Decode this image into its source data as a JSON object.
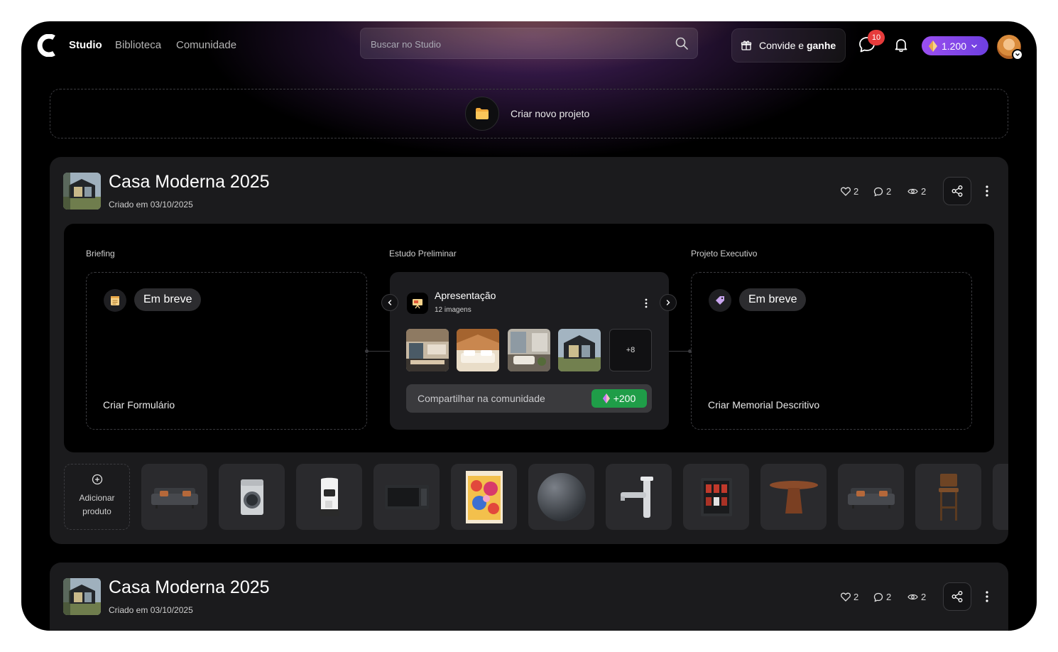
{
  "header": {
    "nav": [
      "Studio",
      "Biblioteca",
      "Comunidade"
    ],
    "search_placeholder": "Buscar no Studio",
    "invite_prefix": "Convide e",
    "invite_bold": "ganhe",
    "notifications_count": "10",
    "credits": "1.200"
  },
  "create_project": {
    "label": "Criar novo projeto"
  },
  "projects": [
    {
      "title": "Casa Moderna 2025",
      "created": "Criado em 03/10/2025",
      "likes": "2",
      "comments": "2",
      "views": "2",
      "stages": {
        "briefing": {
          "label": "Briefing",
          "status": "Em breve",
          "action": "Criar Formulário"
        },
        "preliminar": {
          "label": "Estudo Preliminar",
          "title": "Apresentação",
          "count": "12 imagens",
          "more_images": "+8",
          "share_label": "Compartilhar na comunidade",
          "reward": "+200"
        },
        "executivo": {
          "label": "Projeto Executivo",
          "status": "Em breve",
          "action": "Criar Memorial Descritivo"
        }
      },
      "add_product": {
        "line1": "Adicionar",
        "line2": "produto"
      },
      "products": [
        "sofa",
        "washing-machine",
        "coffee-machine",
        "microwave",
        "poster",
        "sphere",
        "faucet",
        "wine-fridge",
        "round-table",
        "sofa",
        "bar-stool"
      ]
    },
    {
      "title": "Casa Moderna 2025",
      "created": "Criado em 03/10/2025",
      "likes": "2",
      "comments": "2",
      "views": "2"
    }
  ],
  "colors": {
    "accent_purple": "#8b48ee",
    "reward_green": "#1f9d48",
    "badge_red": "#e63b3b"
  }
}
